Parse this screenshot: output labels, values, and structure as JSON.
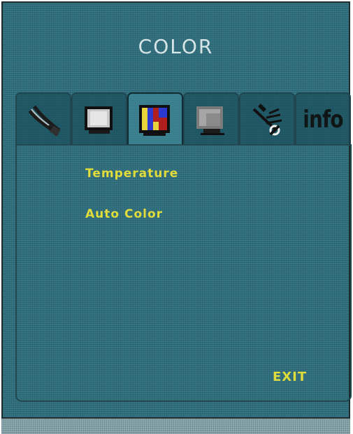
{
  "osd": {
    "title": "COLOR",
    "tabs": [
      {
        "name": "cable-tab",
        "icon": "cable-icon"
      },
      {
        "name": "display-tab",
        "icon": "monitor-screen-icon"
      },
      {
        "name": "color-tab",
        "icon": "color-bars-icon",
        "active": true
      },
      {
        "name": "position-tab",
        "icon": "screen-position-icon"
      },
      {
        "name": "tools-tab",
        "icon": "tools-icon"
      },
      {
        "name": "info-tab",
        "label": "info"
      }
    ],
    "menu": {
      "temperature": "Temperature",
      "auto_color": "Auto Color",
      "exit": "EXIT"
    },
    "colors": {
      "background": "#2e6d7c",
      "accent_text": "#e0dc3a",
      "title_text": "#d6e4e6"
    }
  }
}
